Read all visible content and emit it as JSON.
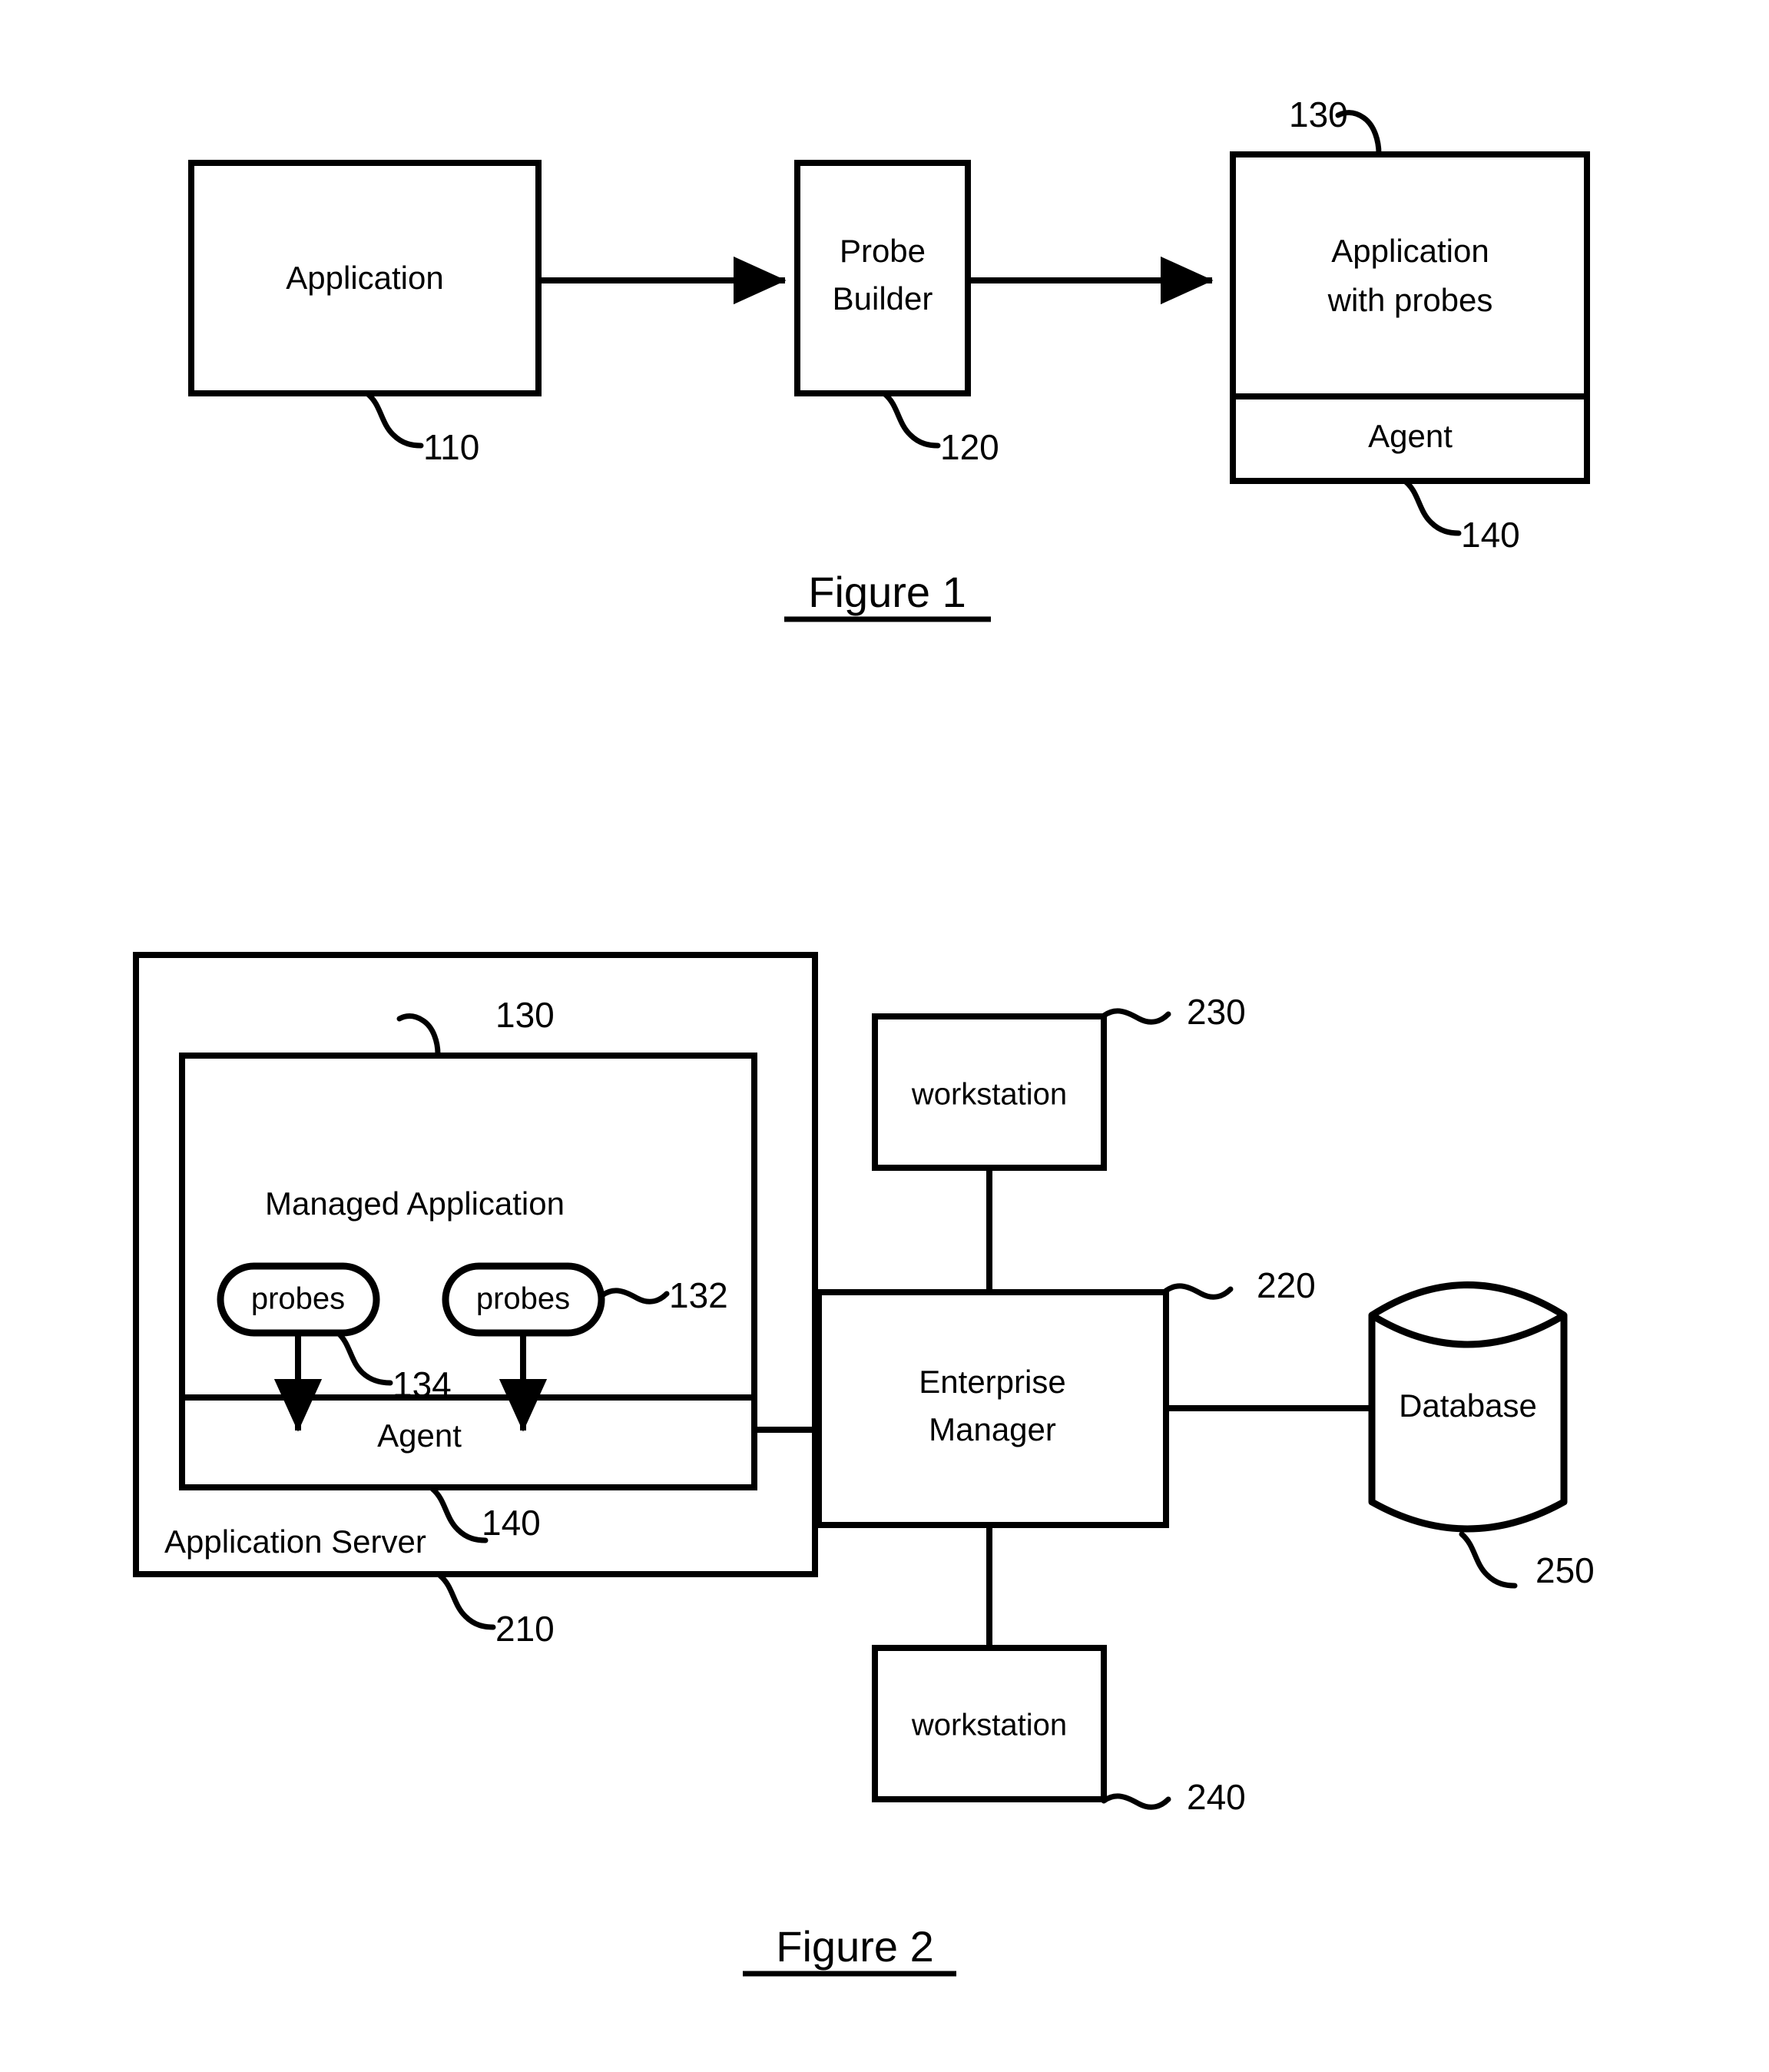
{
  "document": {
    "type": "patent-figure-sheet",
    "background_color": "#ffffff",
    "line_color": "#000000"
  },
  "figure1": {
    "caption": "Figure 1",
    "nodes": {
      "application": {
        "label": "Application",
        "ref": "110"
      },
      "probe_builder": {
        "label_line1": "Probe",
        "label_line2": "Builder",
        "ref": "120"
      },
      "application_with_probes": {
        "label_line1": "Application",
        "label_line2": "with probes",
        "ref": "130"
      },
      "agent": {
        "label": "Agent",
        "ref": "140"
      }
    },
    "arrows": [
      {
        "from": "application",
        "to": "probe_builder",
        "style": "solid-arrowhead"
      },
      {
        "from": "probe_builder",
        "to": "application_with_probes",
        "style": "solid-arrowhead"
      }
    ]
  },
  "figure2": {
    "caption": "Figure 2",
    "nodes": {
      "application_server": {
        "label": "Application Server",
        "ref": "210"
      },
      "managed_application": {
        "label": "Managed Application",
        "ref": "130"
      },
      "probes_left": {
        "label": "probes",
        "ref": "134"
      },
      "probes_right": {
        "label": "probes",
        "ref": "132"
      },
      "agent": {
        "label": "Agent",
        "ref": "140"
      },
      "enterprise_manager": {
        "label_line1": "Enterprise",
        "label_line2": "Manager",
        "ref": "220"
      },
      "workstation_top": {
        "label": "workstation",
        "ref": "230"
      },
      "workstation_bottom": {
        "label": "workstation",
        "ref": "240"
      },
      "database": {
        "label": "Database",
        "ref": "250"
      }
    },
    "connections": [
      {
        "from": "agent",
        "to": "enterprise_manager",
        "style": "line"
      },
      {
        "from": "workstation_top",
        "to": "enterprise_manager",
        "style": "line"
      },
      {
        "from": "enterprise_manager",
        "to": "workstation_bottom",
        "style": "line"
      },
      {
        "from": "enterprise_manager",
        "to": "database",
        "style": "line"
      },
      {
        "from": "probes_left",
        "to": "agent",
        "style": "arrow-down"
      },
      {
        "from": "probes_right",
        "to": "agent",
        "style": "arrow-down"
      }
    ]
  }
}
